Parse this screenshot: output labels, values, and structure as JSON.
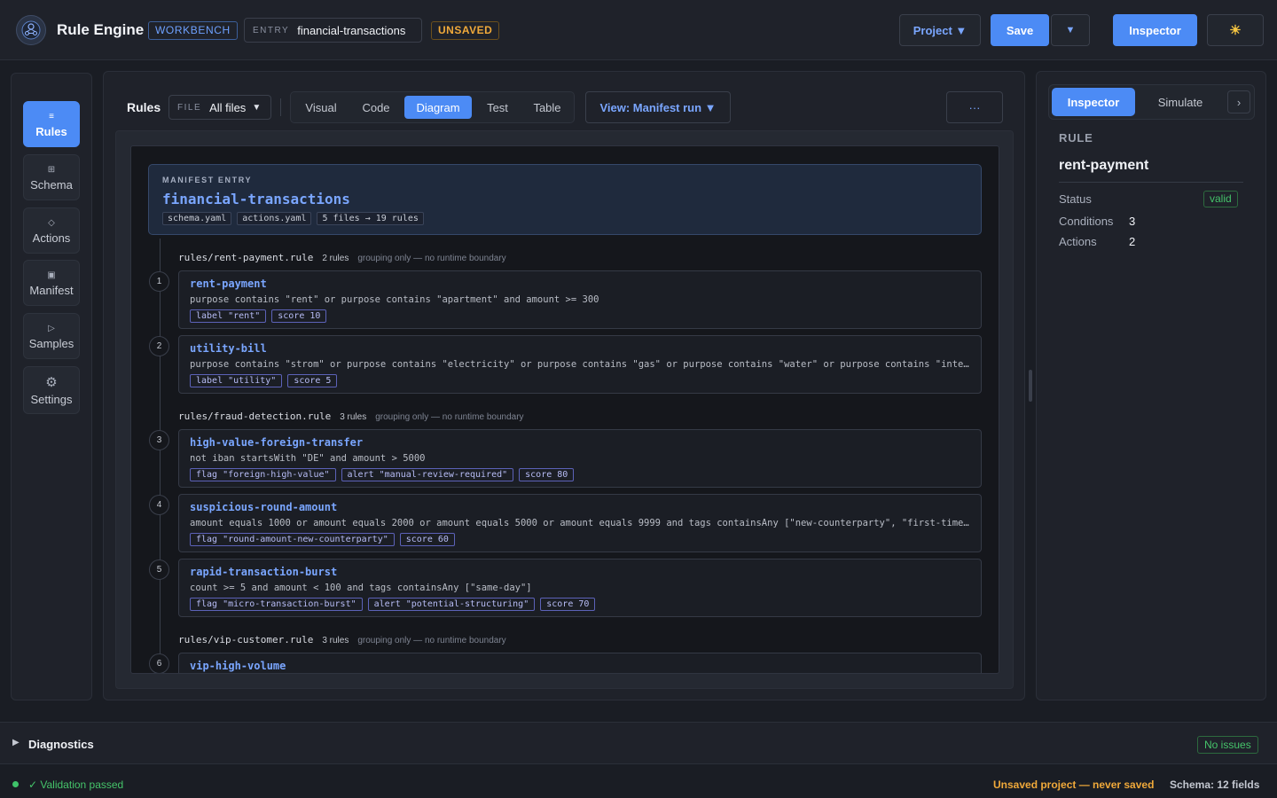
{
  "header": {
    "title": "Rule Engine",
    "workbench_badge": "WORKBENCH",
    "entry_label": "ENTRY",
    "entry_value": "financial-transactions",
    "unsaved_badge": "UNSAVED",
    "project_button": "Project ▼",
    "save_button": "Save",
    "save_menu_button": "▼",
    "inspector_button": "Inspector",
    "theme_toggle_icon": "sun-icon"
  },
  "sidebar": {
    "items": [
      {
        "label": "Rules",
        "icon": "≡",
        "active": true
      },
      {
        "label": "Schema",
        "icon": "⊞"
      },
      {
        "label": "Actions",
        "icon": "◇"
      },
      {
        "label": "Manifest",
        "icon": "▣"
      },
      {
        "label": "Samples",
        "icon": "▷"
      },
      {
        "label": "Settings",
        "icon": "⚙"
      }
    ]
  },
  "toolbar": {
    "title": "Rules",
    "file_label": "FILE",
    "file_value": "All files",
    "tabs": [
      {
        "label": "Visual"
      },
      {
        "label": "Code"
      },
      {
        "label": "Diagram",
        "active": true
      },
      {
        "label": "Test"
      },
      {
        "label": "Table"
      }
    ],
    "view_button": "View: Manifest run ▼",
    "more_button": "···"
  },
  "manifest": {
    "caption": "MANIFEST ENTRY",
    "name": "financial-transactions",
    "chips": [
      "schema.yaml",
      "actions.yaml",
      "5 files → 19 rules"
    ]
  },
  "groups": [
    {
      "path": "rules/rent-payment.rule",
      "count": "2 rules",
      "note": "grouping only — no runtime boundary"
    },
    {
      "path": "rules/fraud-detection.rule",
      "count": "3 rules",
      "note": "grouping only — no runtime boundary"
    },
    {
      "path": "rules/vip-customer.rule",
      "count": "3 rules",
      "note": "grouping only — no runtime boundary"
    }
  ],
  "rules": [
    {
      "num": "1",
      "name": "rent-payment",
      "condition": "purpose contains \"rent\" or purpose contains \"apartment\" and amount >= 300",
      "actions": [
        "label \"rent\"",
        "score 10"
      ]
    },
    {
      "num": "2",
      "name": "utility-bill",
      "condition": "purpose contains \"strom\" or purpose contains \"electricity\" or purpose contains \"gas\" or purpose contains \"water\" or purpose contains \"internet\"",
      "actions": [
        "label \"utility\"",
        "score 5"
      ]
    },
    {
      "num": "3",
      "name": "high-value-foreign-transfer",
      "condition": "not iban startsWith \"DE\" and amount > 5000",
      "actions": [
        "flag \"foreign-high-value\"",
        "alert \"manual-review-required\"",
        "score 80"
      ]
    },
    {
      "num": "4",
      "name": "suspicious-round-amount",
      "condition": "amount equals 1000 or amount equals 2000 or amount equals 5000 or amount equals 9999 and tags containsAny [\"new-counterparty\", \"first-time\"]",
      "actions": [
        "flag \"round-amount-new-counterparty\"",
        "score 60"
      ]
    },
    {
      "num": "5",
      "name": "rapid-transaction-burst",
      "condition": "count >= 5 and amount < 100 and tags containsAny [\"same-day\"]",
      "actions": [
        "flag \"micro-transaction-burst\"",
        "alert \"potential-structuring\"",
        "score 70"
      ]
    },
    {
      "num": "6",
      "name": "vip-high-volume",
      "condition": "",
      "actions": []
    }
  ],
  "inspector": {
    "tabs": [
      {
        "label": "Inspector",
        "active": true
      },
      {
        "label": "Simulate"
      }
    ],
    "chevron": "›",
    "caption": "RULE",
    "name": "rent-payment",
    "status_label": "Status",
    "status_value": "valid",
    "conditions_label": "Conditions",
    "conditions_value": "3",
    "actions_label": "Actions",
    "actions_value": "2"
  },
  "diagnostics": {
    "title": "Diagnostics",
    "badge": "No issues"
  },
  "statusbar": {
    "validation": "✓ Validation passed",
    "unsaved": "Unsaved project — never saved",
    "schema": "Schema: 12 fields"
  },
  "colors": {
    "accent": "#4c8bf5",
    "success": "#45c46a",
    "warning": "#f0a93a",
    "background": "#1a1d24"
  }
}
